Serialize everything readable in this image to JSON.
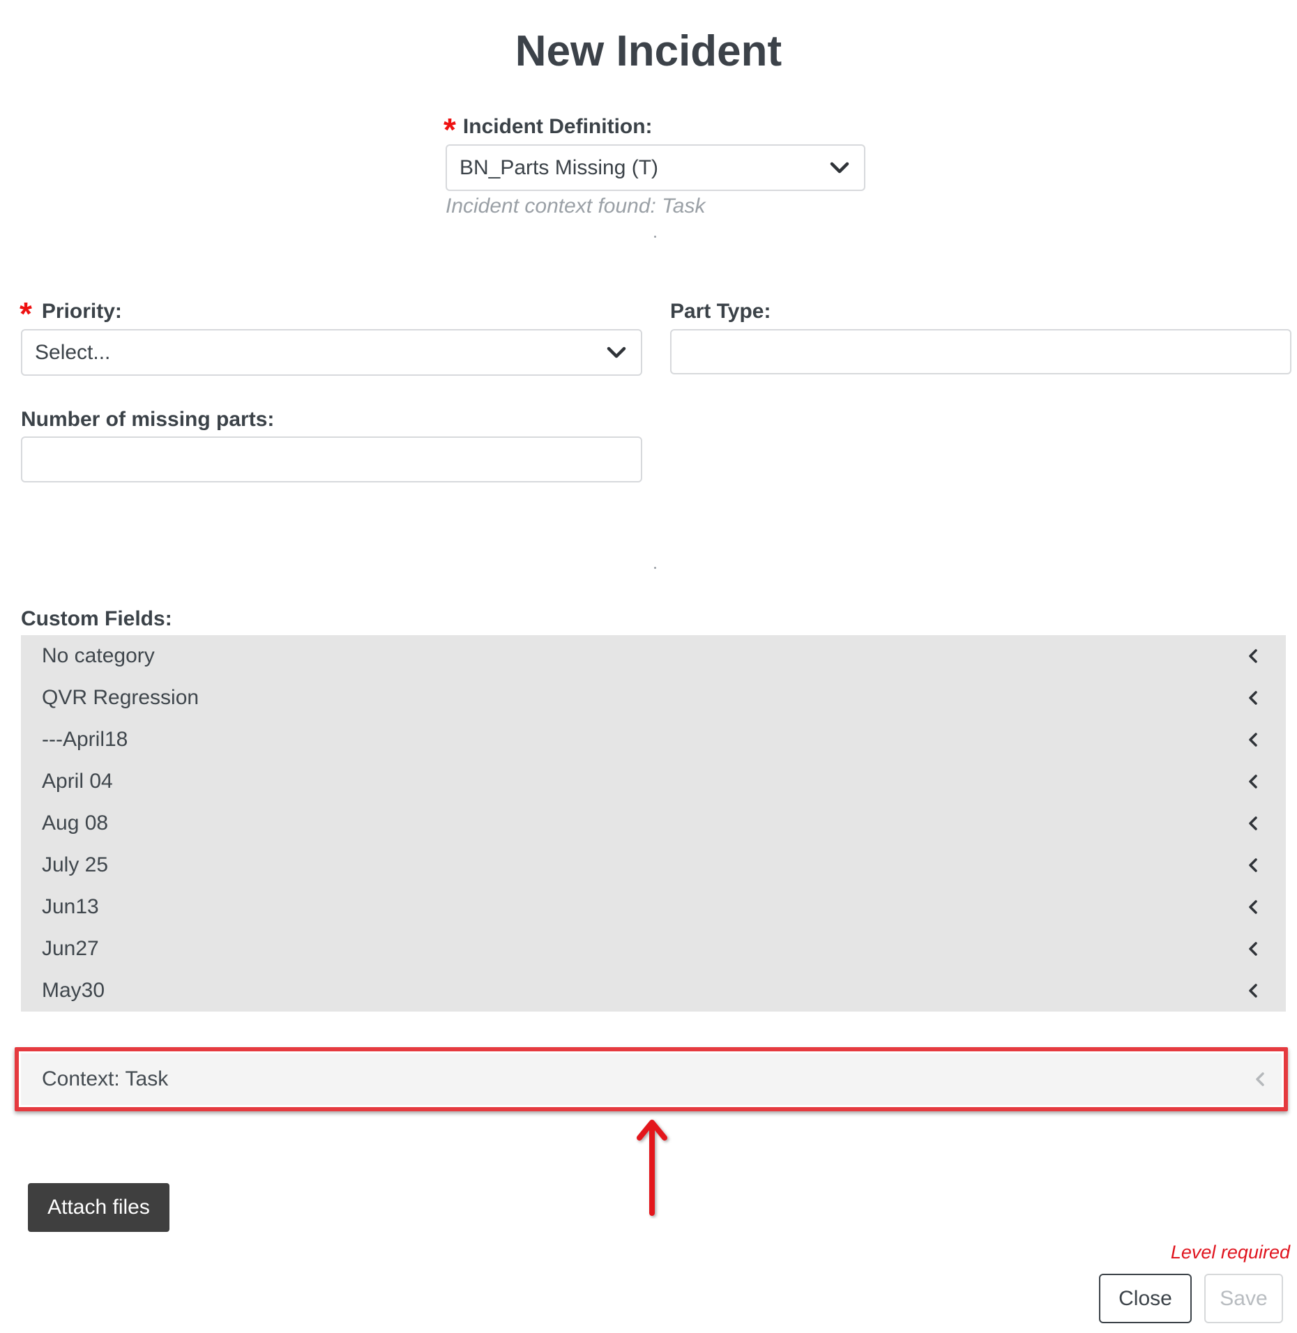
{
  "page": {
    "title": "New Incident"
  },
  "incident_definition": {
    "label": "Incident Definition:",
    "required": true,
    "required_marker": "*",
    "selected_value": "BN_Parts Missing (T)",
    "hint": "Incident context found: Task"
  },
  "priority": {
    "label": "Priority:",
    "required": true,
    "required_marker": "*",
    "placeholder": "Select..."
  },
  "part_type": {
    "label": "Part Type:",
    "value": ""
  },
  "missing_parts": {
    "label": "Number of missing parts:",
    "value": ""
  },
  "custom_fields": {
    "label": "Custom Fields:",
    "items": [
      {
        "label": "No category"
      },
      {
        "label": "QVR Regression"
      },
      {
        "label": "---April18"
      },
      {
        "label": "April 04"
      },
      {
        "label": "Aug 08"
      },
      {
        "label": "July 25"
      },
      {
        "label": "Jun13"
      },
      {
        "label": "Jun27"
      },
      {
        "label": "May30"
      }
    ]
  },
  "context": {
    "label": "Context: Task"
  },
  "annotation": {
    "highlight_color": "#e53a3f",
    "arrow_color": "#e3141c"
  },
  "actions": {
    "attach_label": "Attach files",
    "level_required": "Level required",
    "close_label": "Close",
    "save_label": "Save",
    "save_disabled": true
  },
  "colors": {
    "required": "#ee1111",
    "attach_button_bg": "#3f3f3f",
    "custom_fields_bg": "#e5e5e5",
    "error_text": "#e0141e"
  }
}
